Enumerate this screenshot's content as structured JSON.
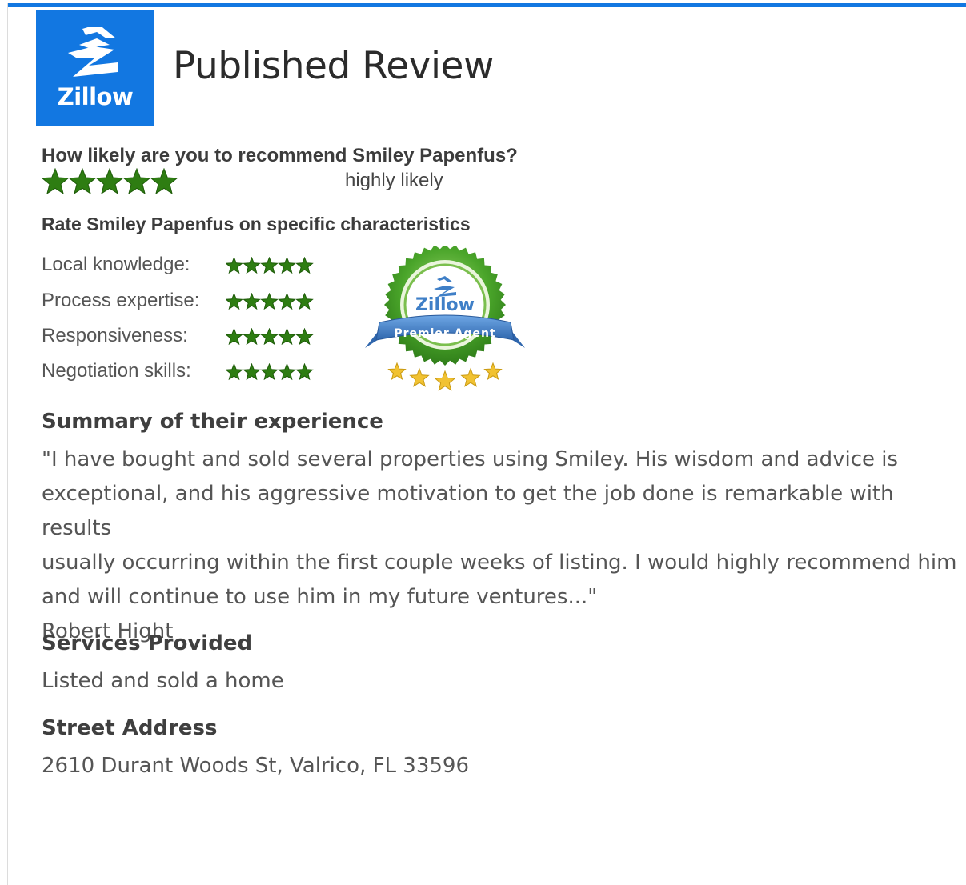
{
  "header": {
    "logo_text": "Zillow",
    "title": "Published Review"
  },
  "recommend": {
    "question": "How likely are you to recommend Smiley Papenfus?",
    "rating": 5,
    "rating_max": 5,
    "rating_label": "highly likely"
  },
  "characteristics": {
    "heading": "Rate Smiley Papenfus on specific characteristics",
    "items": [
      {
        "label": "Local knowledge:",
        "rating": 5
      },
      {
        "label": "Process expertise:",
        "rating": 5
      },
      {
        "label": "Responsiveness:",
        "rating": 5
      },
      {
        "label": "Negotiation skills:",
        "rating": 5
      }
    ]
  },
  "badge": {
    "brand": "Zillow",
    "ribbon": "Premier Agent"
  },
  "summary": {
    "heading": "Summary of their experience",
    "lines": [
      "\"I have bought and sold several properties using Smiley.  His wisdom and advice is",
      "exceptional, and his aggressive motivation to get the job done is remarkable with results",
      "usually occurring within the first couple weeks of listing.  I would highly recommend him",
      "and will continue to use him in my future ventures...\""
    ],
    "reviewer": "Robert Hight"
  },
  "services": {
    "heading": "Services Provided",
    "value": "Listed and sold a home"
  },
  "address": {
    "heading": "Street Address",
    "value": "2610 Durant Woods St, Valrico, FL 33596"
  },
  "colors": {
    "brand_blue": "#1277e1",
    "star_green": "#2e7d12",
    "badge_green": "#4aa52a",
    "ribbon_blue": "#3f7fc7",
    "badge_star_gold": "#f1c232"
  },
  "icons": {
    "logo": "zillow-z-icon",
    "rating": "star-icon",
    "badge": "premier-agent-badge-icon"
  }
}
